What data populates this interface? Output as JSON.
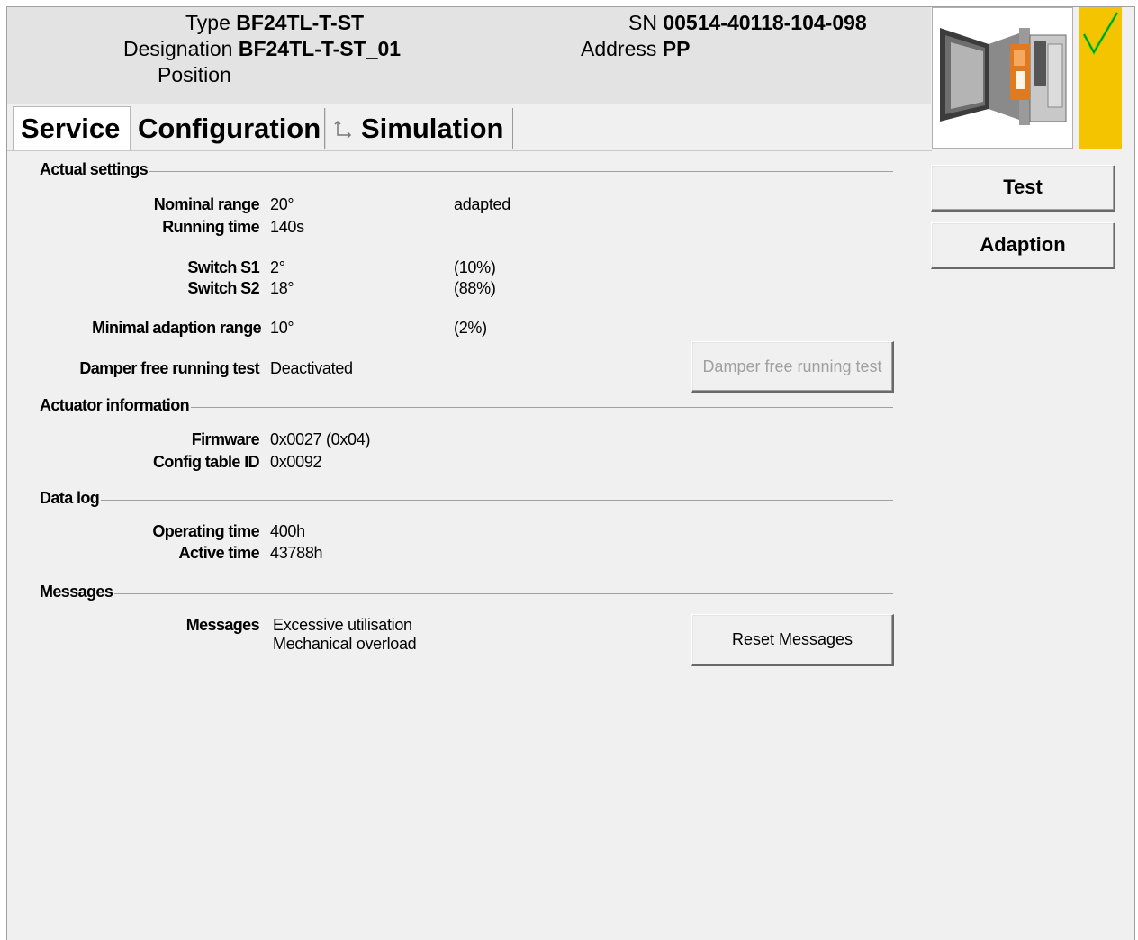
{
  "header": {
    "type_label": "Type",
    "type_value": "BF24TL-T-ST",
    "designation_label": "Designation",
    "designation_value": "BF24TL-T-ST_01",
    "position_label": "Position",
    "sn_label": "SN",
    "sn_value": "00514-40118-104-098",
    "address_label": "Address",
    "address_value": "PP"
  },
  "tabs": [
    {
      "label": "Service",
      "active": true
    },
    {
      "label": "Configuration",
      "active": false
    },
    {
      "label": "Simulation",
      "active": false,
      "icon": "arrow-branch-icon"
    }
  ],
  "status": {
    "color": "#f5c400",
    "icon": "checkmark-icon",
    "check_color": "#1fd21f"
  },
  "side_buttons": {
    "test": "Test",
    "adaption": "Adaption"
  },
  "actual_settings": {
    "title": "Actual settings",
    "nominal_range_label": "Nominal range",
    "nominal_range_value": "20°",
    "nominal_range_extra": "adapted",
    "running_time_label": "Running time",
    "running_time_value": "140s",
    "switch_s1_label": "Switch S1",
    "switch_s1_value": "2°",
    "switch_s1_pct": "(10%)",
    "switch_s2_label": "Switch S2",
    "switch_s2_value": "18°",
    "switch_s2_pct": "(88%)",
    "min_adaption_label": "Minimal adaption range",
    "min_adaption_value": "10°",
    "min_adaption_pct": "(2%)",
    "damper_test_label": "Damper free running test",
    "damper_test_value": "Deactivated",
    "damper_test_button": "Damper free running test"
  },
  "actuator_information": {
    "title": "Actuator information",
    "firmware_label": "Firmware",
    "firmware_value": "0x0027 (0x04)",
    "config_table_label": "Config table ID",
    "config_table_value": "0x0092"
  },
  "data_log": {
    "title": "Data log",
    "operating_time_label": "Operating time",
    "operating_time_value": "400h",
    "active_time_label": "Active time",
    "active_time_value": "43788h"
  },
  "messages": {
    "title": "Messages",
    "label": "Messages",
    "items": [
      "Excessive utilisation",
      "Mechanical overload"
    ],
    "reset_button": "Reset Messages"
  }
}
